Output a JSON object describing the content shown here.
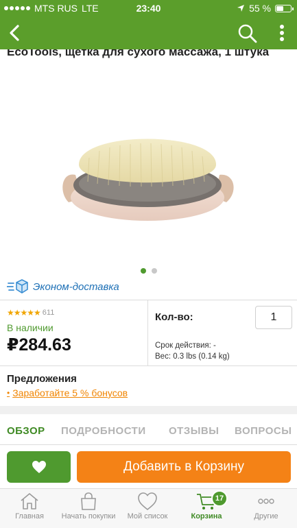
{
  "status_bar": {
    "carrier": "MTS RUS",
    "network": "LTE",
    "time": "23:40",
    "battery": "55 %",
    "battery_level": 0.55
  },
  "header": {
    "back_icon": "chevron-left-icon",
    "search_icon": "search-icon",
    "more_icon": "more-vertical-icon",
    "background": "#5b9e2b"
  },
  "product": {
    "title": "EcoTools, щетка для сухого массажа, 1 штука",
    "image": "dry-brush-image",
    "image_pages": 2,
    "image_page_active": 1,
    "delivery": "Эконом-доставка",
    "rating_value": 4.5,
    "rating_count": "611",
    "availability": "В наличии",
    "price": "₽284.63",
    "qty_label": "Кол-во:",
    "qty_value": "1",
    "shelf_life": "Срок действия: -",
    "weight": "Вес: 0.3 lbs (0.14 kg)"
  },
  "offers": {
    "label": "Предложения",
    "bullet": "•",
    "link": "Заработайте 5 % бонусов"
  },
  "tabs": [
    {
      "label": "ОБЗОР",
      "active": true
    },
    {
      "label": "ПОДРОБНОСТИ",
      "active": false
    },
    {
      "label": "ОТЗЫВЫ",
      "active": false
    },
    {
      "label": "ВОПРОСЫ",
      "active": false
    }
  ],
  "actions": {
    "favorite_icon": "heart-icon",
    "add_to_cart": "Добавить в Корзину",
    "favorite_color": "#4f9a2f",
    "add_color": "#f48216"
  },
  "tabbar": {
    "items": [
      {
        "label": "Главная",
        "icon": "home-icon",
        "active": false
      },
      {
        "label": "Начать покупки",
        "icon": "shopping-bag-icon",
        "active": false
      },
      {
        "label": "Мой список",
        "icon": "heart-outline-icon",
        "active": false
      },
      {
        "label": "Корзина",
        "icon": "cart-icon",
        "active": true,
        "badge": "17"
      },
      {
        "label": "Другие",
        "icon": "more-horizontal-icon",
        "active": false
      }
    ]
  }
}
